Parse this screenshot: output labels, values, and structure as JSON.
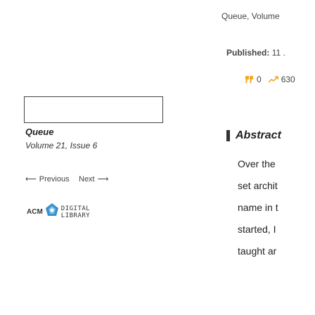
{
  "header": {
    "breadcrumb": "Queue, Volume",
    "published_label": "Published:",
    "published_date": "11 ."
  },
  "metrics": {
    "citations_value": "0",
    "downloads_value": "630",
    "citations_icon": "citation-quote-icon",
    "downloads_icon": "downloads-trend-icon"
  },
  "issue": {
    "journal": "Queue",
    "volume": "Volume 21, Issue 6",
    "previous_label": "Previous",
    "next_label": "Next",
    "previous_arrow": "⟵",
    "next_arrow": "⟶"
  },
  "logo": {
    "acm": "ACM",
    "line1": "DIGITAL",
    "line2": "LIBRARY"
  },
  "abstract": {
    "heading": "Abstract",
    "lines": [
      "Over the",
      "set archit",
      "name in t",
      "started, I",
      "taught ar"
    ]
  },
  "colors": {
    "text": "#333333",
    "accent": "#f5a623"
  }
}
